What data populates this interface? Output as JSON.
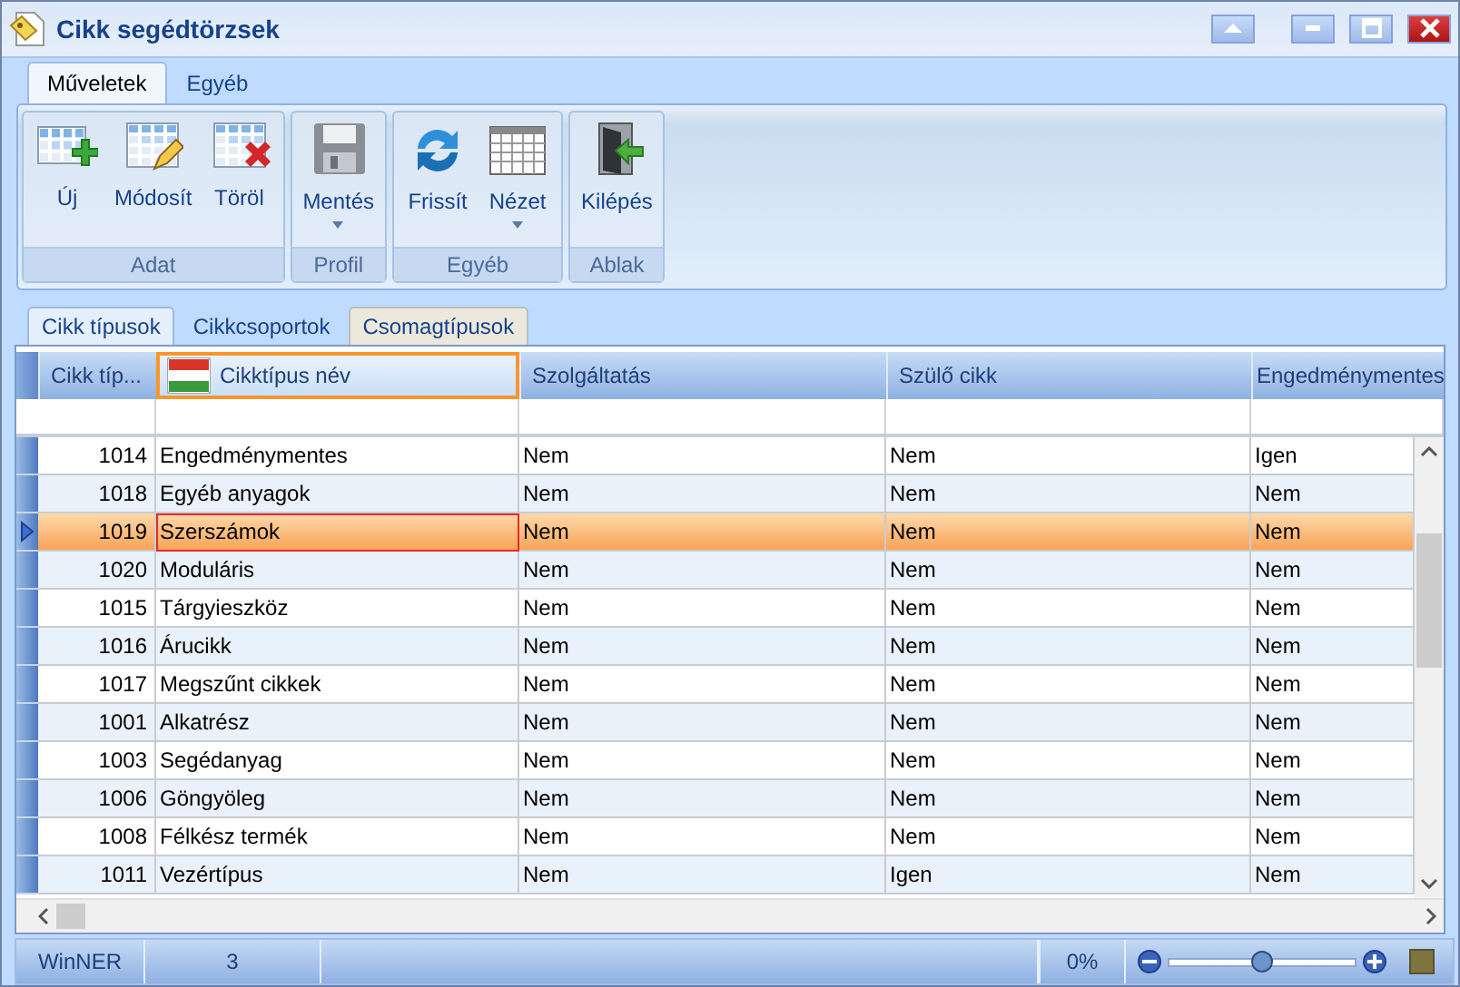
{
  "window": {
    "title": "Cikk segédtörzsek"
  },
  "ribbon": {
    "tabs": [
      {
        "label": "Műveletek",
        "selected": true
      },
      {
        "label": "Egyéb",
        "selected": false
      }
    ],
    "groups": [
      {
        "label": "Adat",
        "buttons": [
          {
            "label": "Új",
            "dropdown": false
          },
          {
            "label": "Módosít",
            "dropdown": false
          },
          {
            "label": "Töröl",
            "dropdown": false
          }
        ]
      },
      {
        "label": "Profil",
        "buttons": [
          {
            "label": "Mentés",
            "dropdown": true
          }
        ]
      },
      {
        "label": "Egyéb",
        "buttons": [
          {
            "label": "Frissít",
            "dropdown": false
          },
          {
            "label": "Nézet",
            "dropdown": true
          }
        ]
      },
      {
        "label": "Ablak",
        "buttons": [
          {
            "label": "Kilépés",
            "dropdown": false
          }
        ]
      }
    ]
  },
  "grid_tabs": [
    {
      "label": "Cikk típusok",
      "selected": true
    },
    {
      "label": "Cikkcsoportok",
      "selected": false
    },
    {
      "label": "Csomagtípusok",
      "selected": false
    }
  ],
  "table": {
    "columns": [
      {
        "label": "Cikk típ...",
        "kind": "number",
        "focused": false
      },
      {
        "label": "Cikktípus név",
        "kind": "text",
        "focused": true
      },
      {
        "label": "Szolgáltatás",
        "kind": "text",
        "focused": false
      },
      {
        "label": "Szülő cikk",
        "kind": "text",
        "focused": false
      },
      {
        "label": "Engedménymentes",
        "kind": "text",
        "focused": false
      }
    ],
    "rows": [
      {
        "cells": [
          "1014",
          "Engedménymentes",
          "Nem",
          "Nem",
          "Igen"
        ],
        "selected": false
      },
      {
        "cells": [
          "1018",
          "Egyéb anyagok",
          "Nem",
          "Nem",
          "Nem"
        ],
        "selected": false
      },
      {
        "cells": [
          "1019",
          "Szerszámok",
          "Nem",
          "Nem",
          "Nem"
        ],
        "selected": true
      },
      {
        "cells": [
          "1020",
          "Moduláris",
          "Nem",
          "Nem",
          "Nem"
        ],
        "selected": false
      },
      {
        "cells": [
          "1015",
          "Tárgyieszköz",
          "Nem",
          "Nem",
          "Nem"
        ],
        "selected": false
      },
      {
        "cells": [
          "1016",
          "Árucikk",
          "Nem",
          "Nem",
          "Nem"
        ],
        "selected": false
      },
      {
        "cells": [
          "1017",
          "Megszűnt cikkek",
          "Nem",
          "Nem",
          "Nem"
        ],
        "selected": false
      },
      {
        "cells": [
          "1001",
          "Alkatrész",
          "Nem",
          "Nem",
          "Nem"
        ],
        "selected": false
      },
      {
        "cells": [
          "1003",
          "Segédanyag",
          "Nem",
          "Nem",
          "Nem"
        ],
        "selected": false
      },
      {
        "cells": [
          "1006",
          "Göngyöleg",
          "Nem",
          "Nem",
          "Nem"
        ],
        "selected": false
      },
      {
        "cells": [
          "1008",
          "Félkész termék",
          "Nem",
          "Nem",
          "Nem"
        ],
        "selected": false
      },
      {
        "cells": [
          "1011",
          "Vezértípus",
          "Nem",
          "Igen",
          "Nem"
        ],
        "selected": false
      }
    ]
  },
  "status_bar": {
    "app": "WinNER",
    "count": "3",
    "progress": "0%",
    "zoom": {
      "level": 0.5
    }
  }
}
